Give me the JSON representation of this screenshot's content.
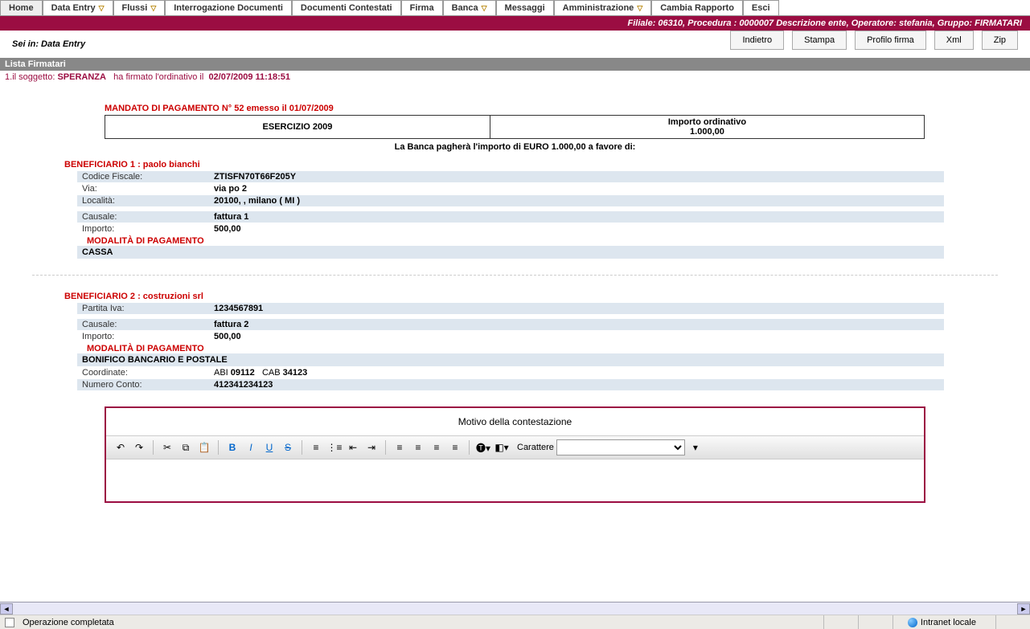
{
  "nav": {
    "home": "Home",
    "data_entry": "Data Entry",
    "flussi": "Flussi",
    "interrogazione": "Interrogazione Documenti",
    "contestati": "Documenti Contestati",
    "firma": "Firma",
    "banca": "Banca",
    "messaggi": "Messaggi",
    "amministrazione": "Amministrazione",
    "cambia": "Cambia Rapporto",
    "esci": "Esci"
  },
  "redbar": "Filiale: 06310, Procedura : 0000007 Descrizione ente, Operatore: stefania, Gruppo: FIRMATARI",
  "breadcrumb": "Sei in: Data Entry",
  "actions": {
    "indietro": "Indietro",
    "stampa": "Stampa",
    "profilo": "Profilo firma",
    "xml": "Xml",
    "zip": "Zip"
  },
  "lista_header": "Lista Firmatari",
  "sign": {
    "num": "1.",
    "pre": "il soggetto:",
    "name": "SPERANZA",
    "mid": "ha firmato l'ordinativo il",
    "dt": "02/07/2009 11:18:51"
  },
  "doc_title": "MANDATO DI PAGAMENTO N° 52  emesso il 01/07/2009",
  "head": {
    "esercizio": "ESERCIZIO 2009",
    "imp_label": "Importo ordinativo",
    "imp_value": "1.000,00"
  },
  "banknote": "La Banca pagherà l'importo di EURO 1.000,00 a favore di:",
  "b1": {
    "title": "BENEFICIARIO 1 :  paolo bianchi",
    "cf_k": "Codice Fiscale:",
    "cf_v": "ZTISFN70T66F205Y",
    "via_k": "Via:",
    "via_v": "via po 2",
    "loc_k": "Località:",
    "loc_v": "20100, , milano   ( MI )",
    "cau_k": "Causale:",
    "cau_v": "fattura 1",
    "imp_k": "Importo:",
    "imp_v": "500,00",
    "mod_title": "MODALITÀ DI PAGAMENTO",
    "mod_val": "CASSA"
  },
  "b2": {
    "title": "BENEFICIARIO 2 :  costruzioni srl",
    "piva_k": "Partita Iva:",
    "piva_v": "1234567891",
    "cau_k": "Causale:",
    "cau_v": "fattura 2",
    "imp_k": "Importo:",
    "imp_v": "500,00",
    "mod_title": "MODALITÀ DI PAGAMENTO",
    "mod_val": "BONIFICO BANCARIO E POSTALE",
    "coord_k": "Coordinate:",
    "coord_abi_lbl": "ABI",
    "coord_abi": "09112",
    "coord_cab_lbl": "CAB",
    "coord_cab": "34123",
    "conto_k": "Numero Conto:",
    "conto_v": "412341234123"
  },
  "editor": {
    "title": "Motivo della contestazione",
    "font_label": "Carattere"
  },
  "status": {
    "msg": "Operazione completata",
    "zone": "Intranet locale"
  }
}
